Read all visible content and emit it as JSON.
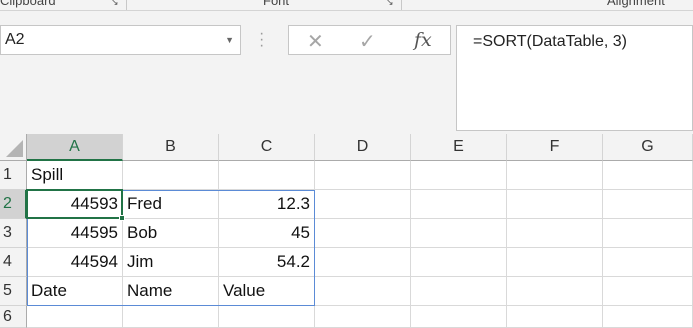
{
  "ribbon": {
    "groups": [
      "Clipboard",
      "Font",
      "Alignment"
    ]
  },
  "namebox": {
    "value": "A2"
  },
  "formula_bar": {
    "cancel_icon": "x-icon",
    "enter_icon": "check-icon",
    "function_label": "fx",
    "formula": "=SORT(DataTable, 3)"
  },
  "columns": [
    "A",
    "B",
    "C",
    "D",
    "E",
    "F",
    "G"
  ],
  "rows": [
    "1",
    "2",
    "3",
    "4",
    "5",
    "6"
  ],
  "cells": {
    "r1": {
      "a": "Spill"
    },
    "r2": {
      "a": "44593",
      "b": "Fred",
      "c": "12.3"
    },
    "r3": {
      "a": "44595",
      "b": "Bob",
      "c": "45"
    },
    "r4": {
      "a": "44594",
      "b": "Jim",
      "c": "54.2"
    },
    "r5": {
      "a": "Date",
      "b": "Name",
      "c": "Value"
    }
  },
  "colors": {
    "selection": "#217346",
    "spill_border": "#5b8bd6"
  }
}
